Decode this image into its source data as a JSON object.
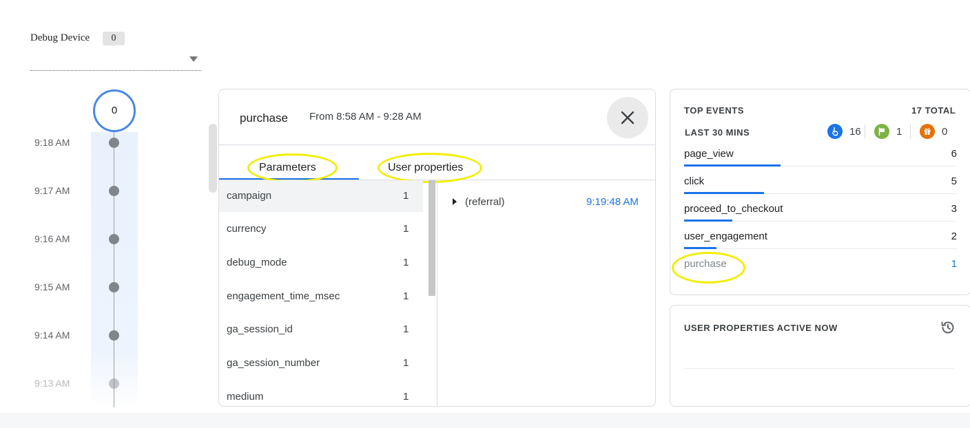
{
  "debug_device": {
    "label": "Debug Device",
    "count": "0"
  },
  "timeline": {
    "top_count": "0",
    "times": [
      "9:18 AM",
      "9:17 AM",
      "9:16 AM",
      "9:15 AM",
      "9:14 AM",
      "9:13 AM"
    ]
  },
  "event_detail": {
    "event_name": "purchase",
    "time_range": "From 8:58 AM - 9:28 AM",
    "tabs": [
      {
        "label": "Parameters",
        "active": true
      },
      {
        "label": "User properties",
        "active": false
      }
    ],
    "parameters": [
      {
        "name": "campaign",
        "count": "1"
      },
      {
        "name": "currency",
        "count": "1"
      },
      {
        "name": "debug_mode",
        "count": "1"
      },
      {
        "name": "engagement_time_msec",
        "count": "1"
      },
      {
        "name": "ga_session_id",
        "count": "1"
      },
      {
        "name": "ga_session_number",
        "count": "1"
      },
      {
        "name": "medium",
        "count": "1"
      }
    ],
    "value": {
      "text": "(referral)",
      "time": "9:19:48 AM"
    }
  },
  "top_events": {
    "title": "TOP EVENTS",
    "total": "17 TOTAL",
    "subtitle": "LAST 30 MINS",
    "stats": [
      {
        "icon": "touch-icon",
        "count": "16",
        "color": "#1a73e8"
      },
      {
        "icon": "flag-icon",
        "count": "1",
        "color": "#7cb342"
      },
      {
        "icon": "gift-icon",
        "count": "0",
        "color": "#e8710a"
      }
    ],
    "events": [
      {
        "name": "page_view",
        "count": "6",
        "share": 0.353
      },
      {
        "name": "click",
        "count": "5",
        "share": 0.294
      },
      {
        "name": "proceed_to_checkout",
        "count": "3",
        "share": 0.176
      },
      {
        "name": "user_engagement",
        "count": "2",
        "share": 0.118
      },
      {
        "name": "purchase",
        "count": "1",
        "share": 0.059
      }
    ]
  },
  "user_properties": {
    "title": "USER PROPERTIES ACTIVE NOW",
    "icon": "history-icon"
  },
  "colors": {
    "accent": "#1a73e8",
    "highlight": "#f2ee00"
  }
}
